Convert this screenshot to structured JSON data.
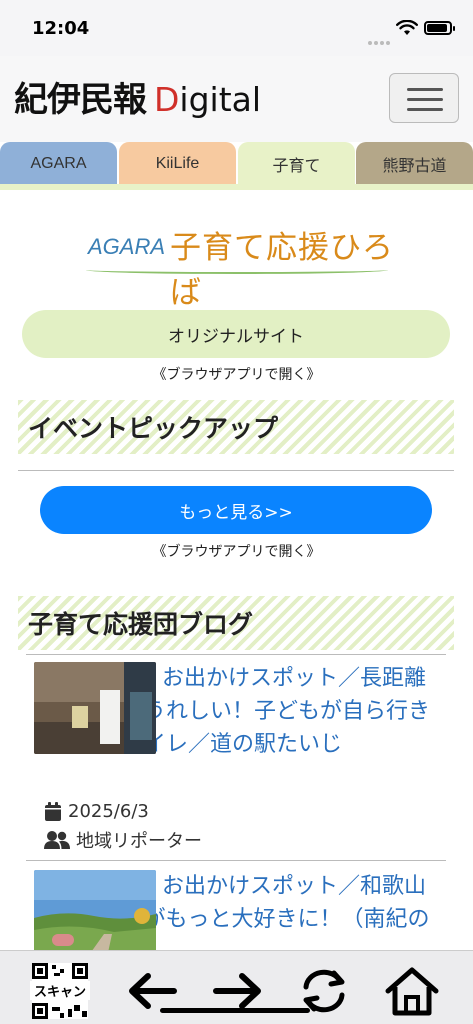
{
  "status": {
    "time": "12:04"
  },
  "header": {
    "logo_main": "紀伊民報",
    "logo_sub_first": "D",
    "logo_sub_rest": "igital"
  },
  "tabs": [
    {
      "label": "AGARA",
      "color": "#8fb0d8"
    },
    {
      "label": "KiiLife",
      "color": "#f7caa0"
    },
    {
      "label": "子育て",
      "color": "#e8f2c8"
    },
    {
      "label": "熊野古道",
      "color": "#b4a789"
    }
  ],
  "banner": {
    "brand": "AGARA",
    "title": "子育て応援ひろば"
  },
  "original_site": {
    "label": "オリジナルサイト",
    "note": "《ブラウザアプリで開く》"
  },
  "event_section": {
    "heading": "イベントピックアップ",
    "more_label": "もっと見る>>",
    "note": "《ブラウザアプリで開く》"
  },
  "blog_section": {
    "heading": "子育て応援団ブログ",
    "articles": [
      {
        "title": "お出かけスポット／長距離ドライブにうれしい！子どもが自ら行きたくなるトイレ／道の駅たいじ",
        "date": "2025/6/3",
        "author": "地域リポーター"
      },
      {
        "title": "お出かけスポット／和歌山のフルーツがもっと大好きに！（南紀の分",
        "date": "",
        "author": ""
      }
    ]
  },
  "bottom_bar": {
    "qr_label": "スキャン"
  },
  "colors": {
    "accent_blue": "#0a84ff",
    "link_blue": "#2a6fbd",
    "light_green": "#e2f0c4"
  }
}
